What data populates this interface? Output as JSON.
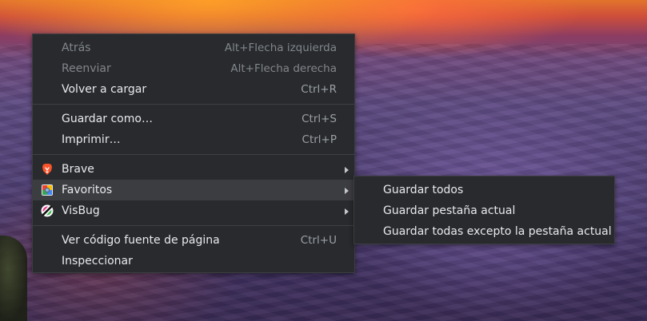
{
  "context_menu": {
    "items": [
      {
        "label": "Atrás",
        "shortcut": "Alt+Flecha izquierda"
      },
      {
        "label": "Reenviar",
        "shortcut": "Alt+Flecha derecha"
      },
      {
        "label": "Volver a cargar",
        "shortcut": "Ctrl+R"
      },
      {
        "label": "Guardar como…",
        "shortcut": "Ctrl+S"
      },
      {
        "label": "Imprimir…",
        "shortcut": "Ctrl+P"
      },
      {
        "label": "Brave",
        "icon": "brave-lion-icon"
      },
      {
        "label": "Favoritos",
        "icon": "bookmarks-extension-icon"
      },
      {
        "label": "VisBug",
        "icon": "visbug-icon"
      },
      {
        "label": "Ver código fuente de página",
        "shortcut": "Ctrl+U"
      },
      {
        "label": "Inspeccionar"
      }
    ],
    "submenu_arrow_icon": "chevron-right-icon"
  },
  "submenu_favoritos": {
    "items": [
      {
        "label": "Guardar todos"
      },
      {
        "label": "Guardar pestaña actual"
      },
      {
        "label": "Guardar todas excepto la pestaña actual"
      }
    ]
  },
  "colors": {
    "menu_bg": "#292a2d",
    "menu_text": "#e8eaed",
    "disabled_text": "#80868b",
    "highlight_bg": "#3c3d41",
    "brave_orange": "#fb542b"
  }
}
